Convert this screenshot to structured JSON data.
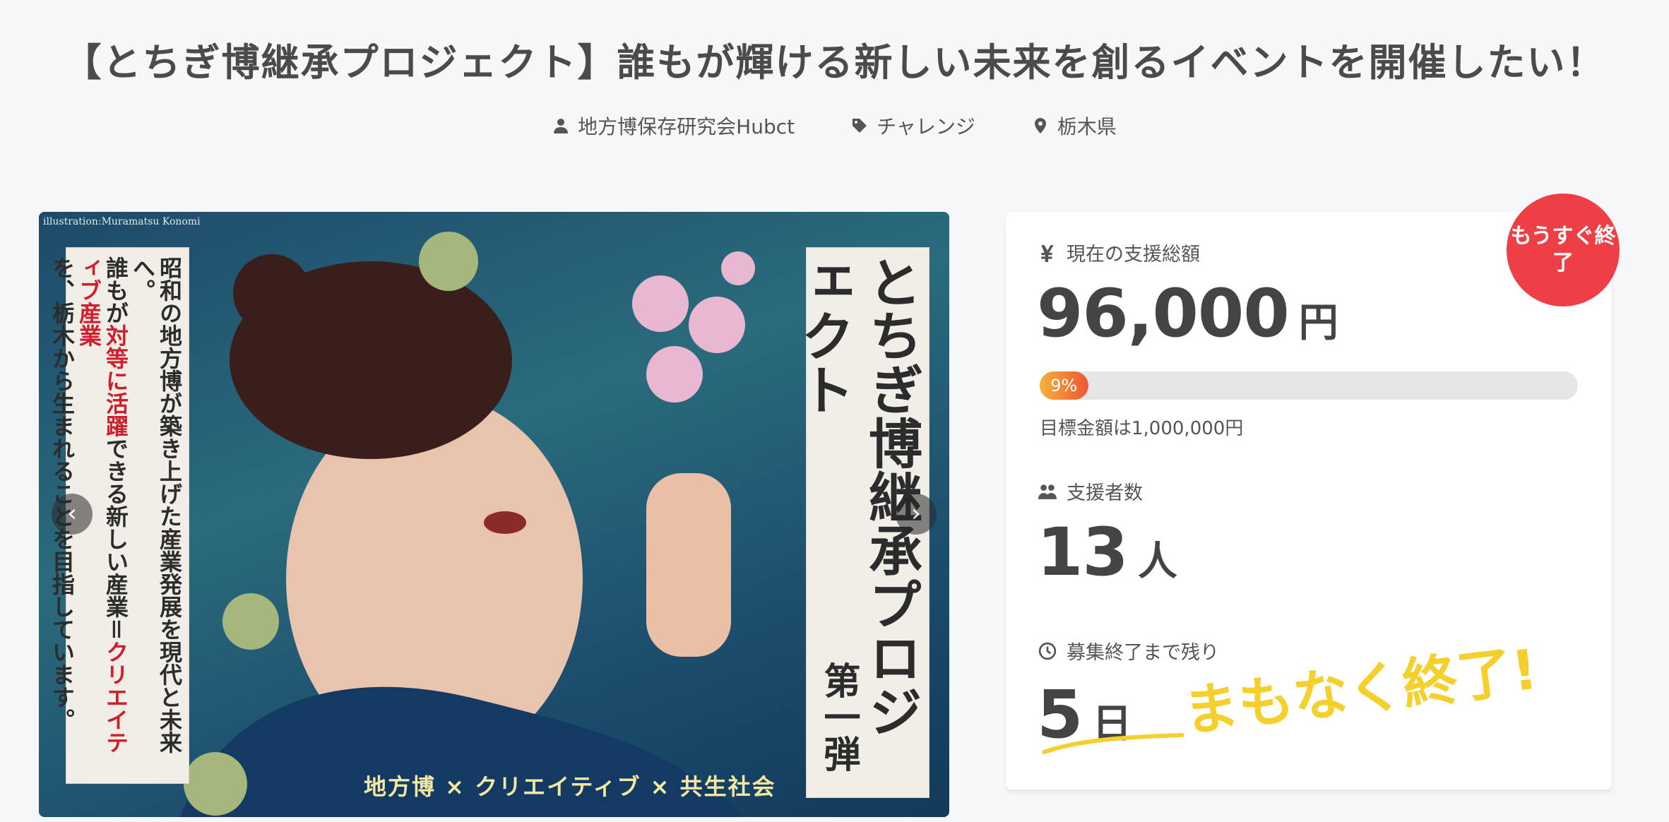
{
  "page": {
    "title": "【とちぎ博継承プロジェクト】誰もが輝ける新しい未来を創るイベントを開催したい！"
  },
  "meta": {
    "owner": "地方博保存研究会Hubct",
    "category": "チャレンジ",
    "location": "栃木県",
    "icons": [
      "person-icon",
      "tag-icon",
      "location-pin-icon"
    ]
  },
  "hero": {
    "credit": "illustration:Muramatsu Konomi",
    "left_text": [
      "昭和の地方博が築き上げた産業発展を現代と未来へ。",
      "誰もが",
      "対等に活躍",
      "できる新しい産業＝",
      "クリエイティブ産業",
      "を、栃木から生まれることを目指しています。"
    ],
    "right_title": "とちぎ博継承プロジェクト",
    "right_sub": "第一弾",
    "slogan": "地方博 × クリエイティブ × 共生社会",
    "prev_label": "‹",
    "next_label": "›"
  },
  "card": {
    "badge": "もうすぐ終了",
    "amount_label": "現在の支援総額",
    "amount": "96,000",
    "amount_unit": "円",
    "progress": 0.09,
    "progress_label": "9%",
    "goal": "目標金額は1,000,000円",
    "supporters_label": "支援者数",
    "supporters": "13",
    "supporters_unit": "人",
    "remaining_label": "募集終了まで残り",
    "remaining": "5",
    "remaining_unit": "日",
    "note": "まもなく終了!!",
    "accent": "#ef3f46",
    "note_color": "#f5cf2c"
  }
}
